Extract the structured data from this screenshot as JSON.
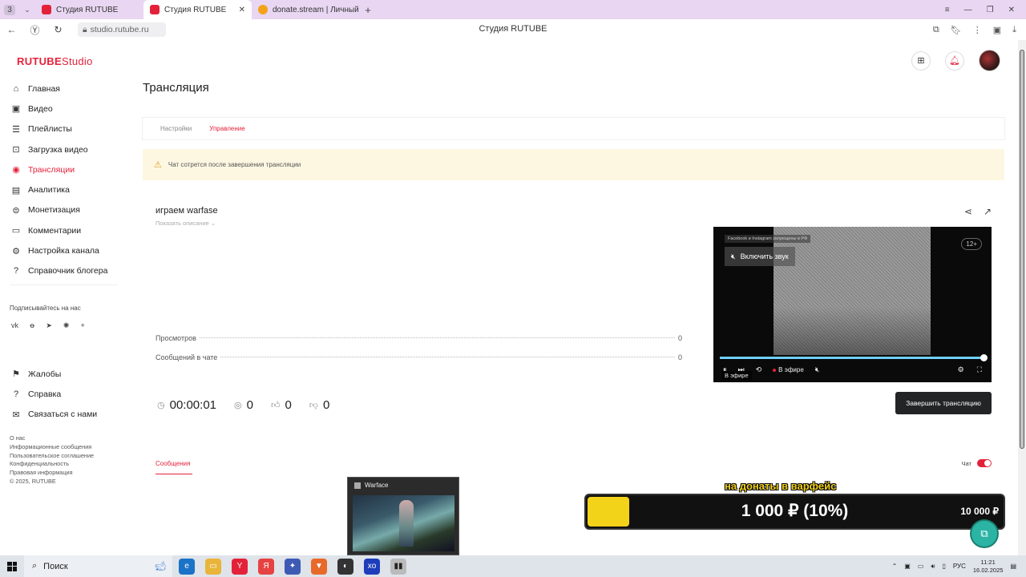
{
  "browser": {
    "tab_count": "3",
    "tabs": [
      {
        "label": "Студия RUTUBE",
        "active": false
      },
      {
        "label": "Студия RUTUBE",
        "active": true
      },
      {
        "label": "donate.stream | Личный к",
        "active": false
      }
    ],
    "url": "studio.rutube.ru",
    "page_title": "Студия RUTUBE"
  },
  "brand": {
    "name": "RUTUBE",
    "suffix": "Studio",
    "accent": "#e3223a"
  },
  "sidebar": {
    "items": [
      {
        "label": "Главная",
        "icon": "home-icon"
      },
      {
        "label": "Видео",
        "icon": "video-icon"
      },
      {
        "label": "Плейлисты",
        "icon": "playlist-icon"
      },
      {
        "label": "Загрузка видео",
        "icon": "upload-icon"
      },
      {
        "label": "Трансляции",
        "icon": "broadcast-icon",
        "active": true
      },
      {
        "label": "Аналитика",
        "icon": "analytics-icon"
      },
      {
        "label": "Монетизация",
        "icon": "monetization-icon"
      },
      {
        "label": "Комментарии",
        "icon": "comments-icon"
      },
      {
        "label": "Настройка канала",
        "icon": "settings-icon"
      },
      {
        "label": "Справочник блогера",
        "icon": "handbook-icon"
      }
    ],
    "social_title": "Подписывайтесь на нас",
    "social": [
      "vk",
      "ok",
      "telegram",
      "dzen",
      "more"
    ],
    "secondary": [
      {
        "label": "Жалобы",
        "icon": "flag-icon"
      },
      {
        "label": "Справка",
        "icon": "help-icon"
      },
      {
        "label": "Связаться с нами",
        "icon": "mail-icon"
      }
    ],
    "footer": [
      "О нас",
      "Информационные сообщения",
      "Пользовательское соглашение",
      "Конфиденциальность",
      "Правовая информация",
      "© 2025, RUTUBE"
    ]
  },
  "page": {
    "title": "Трансляция",
    "tabs": [
      {
        "label": "Настройки",
        "active": false
      },
      {
        "label": "Управление",
        "active": true
      }
    ],
    "warning": "Чат сотрется после завершения трансляции"
  },
  "stream": {
    "title": "играем warfase",
    "show_description": "Показать описание",
    "stats": [
      {
        "label": "Просмотров",
        "value": "0"
      },
      {
        "label": "Сообщений в чате",
        "value": "0"
      }
    ],
    "duration": "00:00:01",
    "viewers": "0",
    "likes": "0",
    "dislikes": "0",
    "end_button": "Завершить трансляцию"
  },
  "player": {
    "notice": "Facebook и Instagram запрещены в РФ",
    "unmute_label": "Включить звук",
    "age_rating": "12+",
    "live_label": "В эфире",
    "live_tooltip": "В эфире",
    "progress": 1.0
  },
  "chat": {
    "tab_label": "Сообщения",
    "toggle_label": "Чат",
    "toggle_on": true
  },
  "donation": {
    "caption": "на донаты в варфейс",
    "amount_text": "1 000 ₽ (10%)",
    "goal_text": "10 000 ₽",
    "progress": 0.1,
    "bar_color": "#f3d21a"
  },
  "taskbar": {
    "search_label": "Поиск",
    "thumbnail_title": "Warface",
    "language": "РУС",
    "time": "11:21",
    "date": "16.02.2025"
  }
}
